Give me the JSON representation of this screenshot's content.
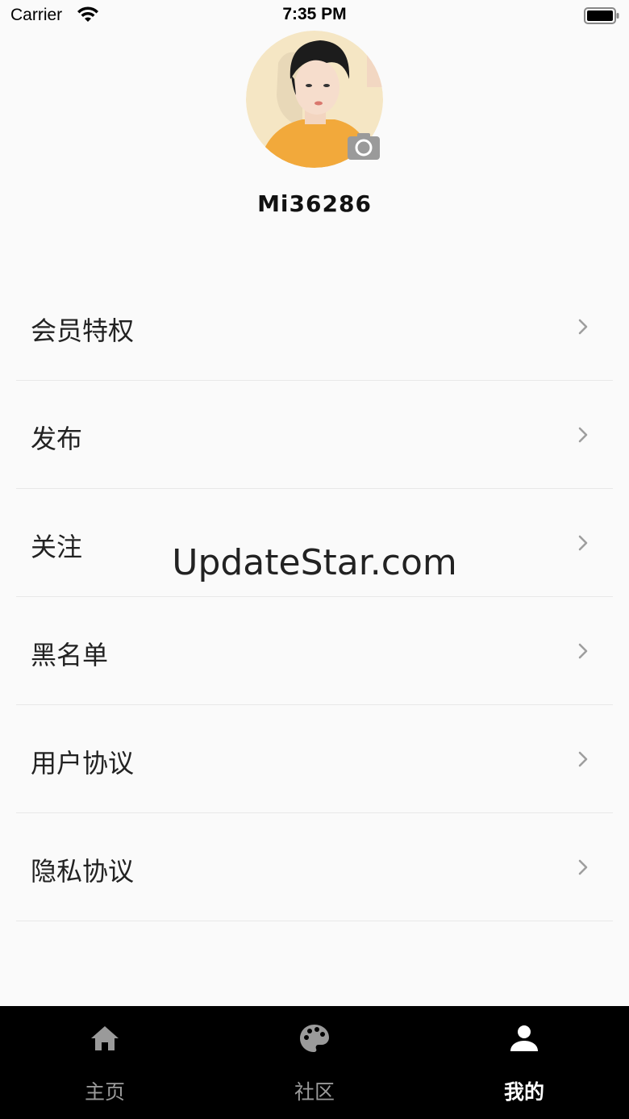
{
  "status_bar": {
    "carrier": "Carrier",
    "time": "7:35 PM"
  },
  "profile": {
    "username": "Mi36286"
  },
  "menu": {
    "items": [
      {
        "label": "会员特权"
      },
      {
        "label": "发布"
      },
      {
        "label": "关注"
      },
      {
        "label": "黑名单"
      },
      {
        "label": "用户协议"
      },
      {
        "label": "隐私协议"
      }
    ]
  },
  "watermark": "UpdateStar.com",
  "tab_bar": {
    "tabs": [
      {
        "label": "主页",
        "icon": "home-icon",
        "active": false
      },
      {
        "label": "社区",
        "icon": "palette-icon",
        "active": false
      },
      {
        "label": "我的",
        "icon": "person-icon",
        "active": true
      }
    ]
  },
  "colors": {
    "background": "#fafafa",
    "tab_bar_bg": "#000000",
    "tab_inactive": "#9a9a9a",
    "tab_active": "#ffffff",
    "divider": "#e8e8e8",
    "chevron": "#9e9e9e"
  }
}
